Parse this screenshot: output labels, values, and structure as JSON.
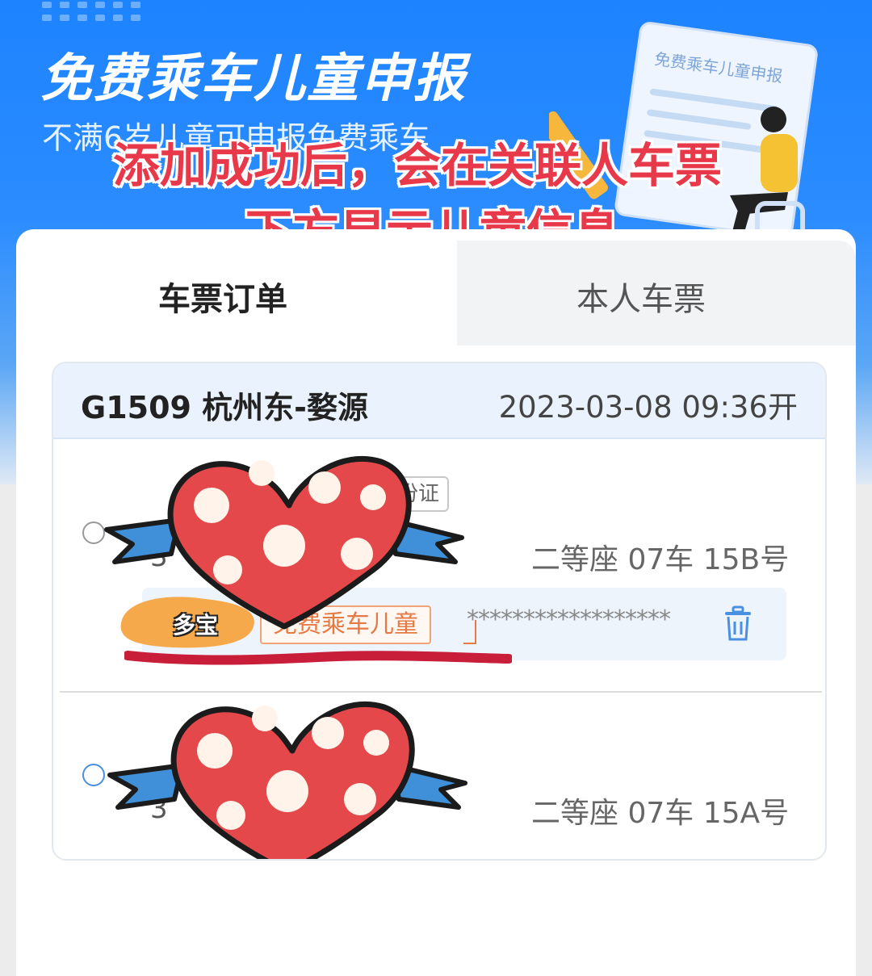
{
  "header": {
    "title": "免费乘车儿童申报",
    "subtitle": "不满6岁儿童可申报免费乘车",
    "illustration_text": "免费乘车儿童申报"
  },
  "overlay_caption": {
    "line1": "添加成功后，会在关联人车票",
    "line2": "下方显示儿童信息"
  },
  "tabs": [
    {
      "label": "车票订单",
      "active": true
    },
    {
      "label": "本人车票",
      "active": false
    }
  ],
  "order": {
    "train": "G1509  杭州东-婺源",
    "departure": "2023-03-08  09:36开",
    "passengers": [
      {
        "id_type": "身份证",
        "seat": "二等座 07车 15B号",
        "seq": "3",
        "child": {
          "name": "多宝",
          "tag": "免费乘车儿童",
          "masked_id": "******************"
        }
      },
      {
        "seat": "二等座 07车 15A号",
        "seq": "3"
      }
    ]
  },
  "colors": {
    "brand_blue": "#1d83ff",
    "caption_red": "#e8394a",
    "child_tag_orange": "#e57a45",
    "header_bg": "#eaf3fd"
  },
  "icons": [
    "trash-icon",
    "heart-sticker-icon"
  ]
}
